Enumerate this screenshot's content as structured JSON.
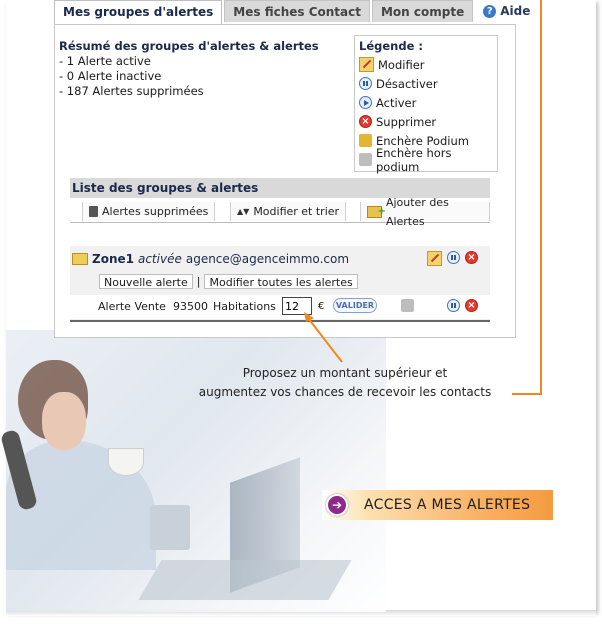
{
  "tabs": [
    {
      "label": "Mes groupes d'alertes",
      "active": true
    },
    {
      "label": "Mes fiches Contact",
      "active": false
    },
    {
      "label": "Mon compte",
      "active": false
    }
  ],
  "help": {
    "label": "Aide",
    "icon": "help-icon"
  },
  "summary": {
    "title": "Résumé des groupes d'alertes & alertes",
    "lines": [
      "- 1 Alerte active",
      "- 0 Alerte inactive",
      "- 187 Alertes supprimées"
    ]
  },
  "legend": {
    "title": "Légende :",
    "items": [
      {
        "label": "Modifier",
        "icon": "edit-icon"
      },
      {
        "label": "Désactiver",
        "icon": "pause-icon"
      },
      {
        "label": "Activer",
        "icon": "play-icon"
      },
      {
        "label": "Supprimer",
        "icon": "delete-icon"
      },
      {
        "label": "Enchère Podium",
        "icon": "podium-icon"
      },
      {
        "label": "Enchère hors podium",
        "icon": "podium-grey-icon"
      }
    ]
  },
  "list": {
    "title": "Liste des groupes & alertes",
    "toolbar": {
      "deleted": "Alertes supprimées",
      "sort": "Modifier et trier",
      "add": "Ajouter des Alertes"
    }
  },
  "zone": {
    "name": "Zone1",
    "status": "activée",
    "email": "agence@agenceimmo.com",
    "new_alert": "Nouvelle alerte",
    "separator": "|",
    "edit_all": "Modifier toutes les alertes"
  },
  "alert": {
    "type": "Alerte Vente",
    "postcode": "93500",
    "category": "Habitations",
    "bid_value": "12",
    "currency": "€",
    "validate": "VALIDER"
  },
  "callout": {
    "line1": "Proposez un montant supérieur et",
    "line2": "augmentez vos chances de recevoir les contacts"
  },
  "cta": {
    "label": "ACCES A MES ALERTES"
  },
  "colors": {
    "accent": "#f08a1c",
    "tab_bg": "#d9d9d9",
    "brand_dark": "#1b2a4a"
  }
}
